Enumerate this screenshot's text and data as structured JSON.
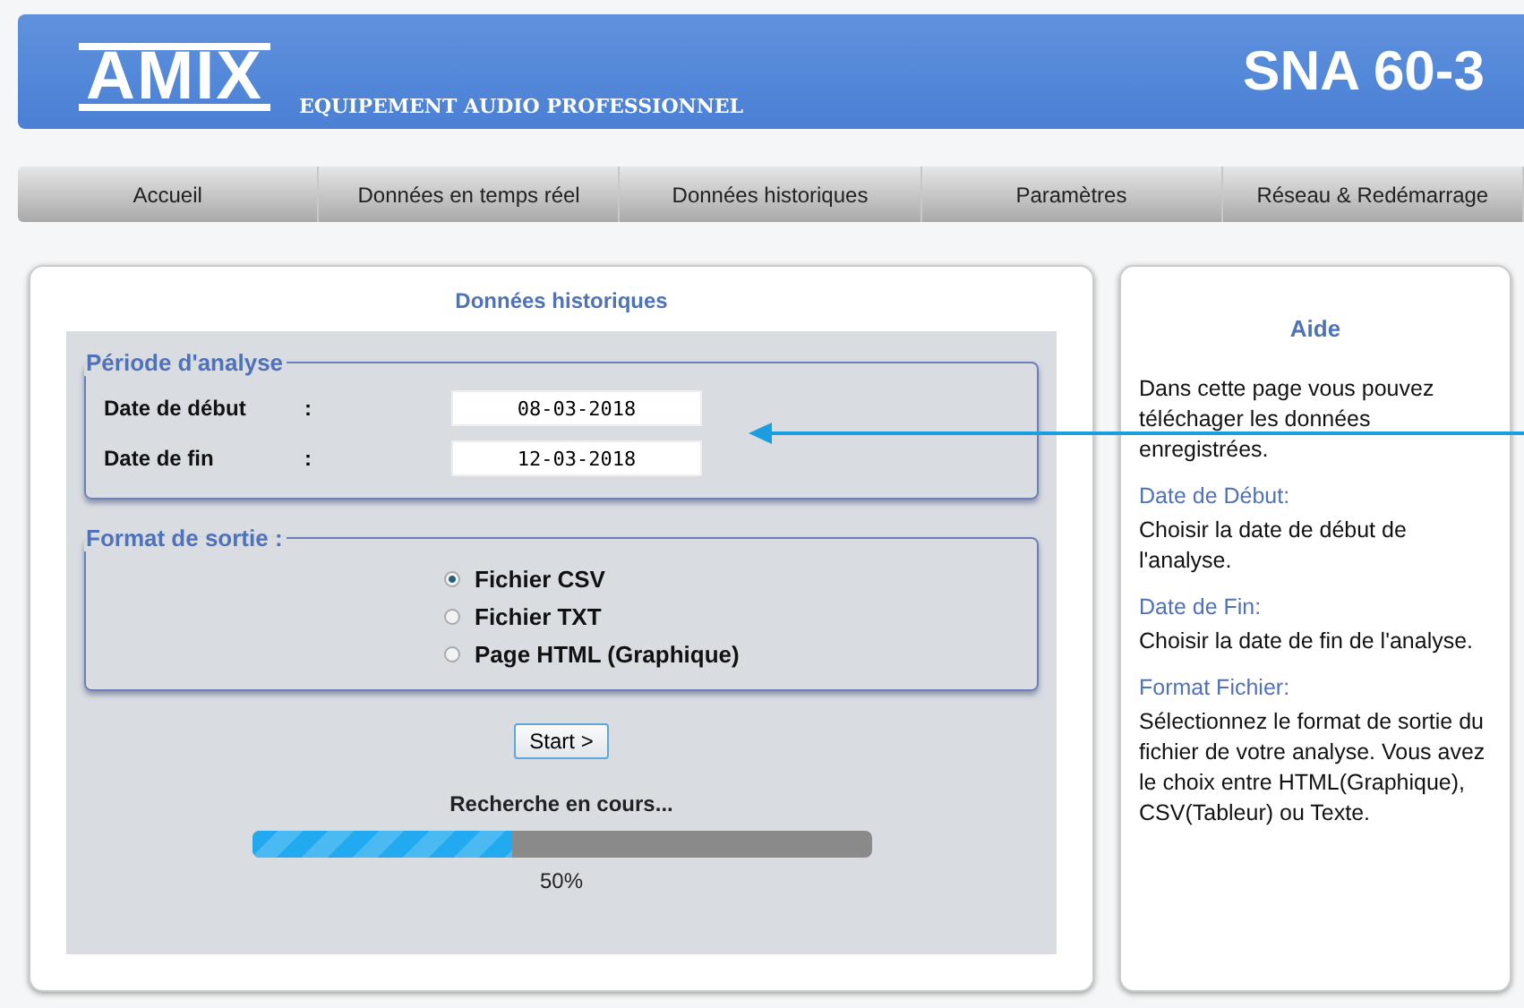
{
  "header": {
    "logo": "AMIX",
    "tagline": "EQUIPEMENT AUDIO PROFESSIONNEL",
    "model": "SNA 60-3"
  },
  "nav": [
    "Accueil",
    "Données en temps réel",
    "Données historiques",
    "Paramètres",
    "Réseau & Redémarrage"
  ],
  "main": {
    "title": "Données historiques",
    "period": {
      "legend": "Période d'analyse",
      "fields": [
        {
          "label": "Date de début",
          "colon": ":",
          "value": "08-03-2018"
        },
        {
          "label": "Date de fin",
          "colon": ":",
          "value": "12-03-2018"
        }
      ]
    },
    "format": {
      "legend": "Format de sortie  :",
      "options": [
        {
          "label": "Fichier CSV",
          "selected": true
        },
        {
          "label": "Fichier TXT",
          "selected": false
        },
        {
          "label": "Page HTML (Graphique)",
          "selected": false
        }
      ]
    },
    "start_button": "Start >",
    "status": "Recherche en cours...",
    "progress": {
      "level": 0.42,
      "reading": "50%"
    }
  },
  "help": {
    "title": "Aide",
    "intro": "Dans cette page vous pouvez téléchager les données enregistrées.",
    "sections": [
      {
        "heading": "Date de Début:",
        "text": "Choisir la date de début de l'analyse."
      },
      {
        "heading": "Date de Fin:",
        "text": "Choisir la date de fin de l'analyse."
      },
      {
        "heading": "Format Fichier:",
        "text": "Sélectionnez le format de sortie du fichier de votre analyse. Vous avez le choix entre HTML(Graphique), CSV(Tableur) ou Texte."
      }
    ]
  }
}
